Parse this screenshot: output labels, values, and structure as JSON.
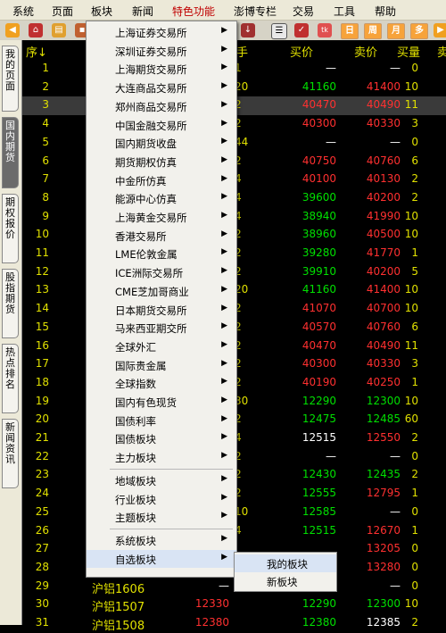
{
  "menubar": [
    "系统",
    "页面",
    "板块",
    "新闻",
    "特色功能",
    "澎博专栏",
    "交易",
    "工具",
    "帮助"
  ],
  "vtabs": [
    "我的页面",
    "国内期货",
    "期权报价",
    "股指期货",
    "热点排名",
    "新闻资讯"
  ],
  "headers": {
    "idx": "序↓",
    "name": "手",
    "buy": "买价",
    "sell": "卖价",
    "buyvol": "买量",
    "sellvol": "卖"
  },
  "toolbar": {
    "btn1": "日",
    "btn2": "周",
    "btn3": "月",
    "btn4": "多"
  },
  "menu_items": [
    {
      "label": "上海证券交易所",
      "sub": true
    },
    {
      "label": "深圳证券交易所",
      "sub": true
    },
    {
      "label": "上海期货交易所",
      "sub": true
    },
    {
      "label": "大连商品交易所",
      "sub": true
    },
    {
      "label": "郑州商品交易所",
      "sub": true
    },
    {
      "label": "中国金融交易所",
      "sub": true
    },
    {
      "label": "国内期货收盘",
      "sub": true
    },
    {
      "label": "期货期权仿真",
      "sub": true
    },
    {
      "label": "中金所仿真",
      "sub": true
    },
    {
      "label": "能源中心仿真",
      "sub": true
    },
    {
      "label": "上海黄金交易所",
      "sub": true
    },
    {
      "label": "香港交易所",
      "sub": true
    },
    {
      "label": "LME伦敦金属",
      "sub": true
    },
    {
      "label": "ICE洲际交易所",
      "sub": true
    },
    {
      "label": "CME芝加哥商业",
      "sub": true
    },
    {
      "label": "日本期货交易所",
      "sub": true
    },
    {
      "label": "马来西亚期交所",
      "sub": true
    },
    {
      "label": "全球外汇",
      "sub": true
    },
    {
      "label": "国际贵金属",
      "sub": true
    },
    {
      "label": "全球指数",
      "sub": true
    },
    {
      "label": "国内有色现货",
      "sub": true
    },
    {
      "label": "国债利率",
      "sub": true
    },
    {
      "label": "国债板块",
      "sub": true
    },
    {
      "label": "主力板块",
      "sub": true
    },
    {
      "label": "地域板块",
      "sub": true
    },
    {
      "label": "行业板块",
      "sub": true
    },
    {
      "label": "主题板块",
      "sub": true
    },
    {
      "label": "系统板块",
      "sub": true
    },
    {
      "label": "自选板块",
      "sub": true
    }
  ],
  "submenu": [
    "我的板块",
    "新板块"
  ],
  "rows": [
    {
      "i": "1",
      "n": "1",
      "b": "—",
      "s": "—",
      "bv": "0",
      "bc": "w",
      "sc": "w"
    },
    {
      "i": "2",
      "n": "20",
      "b": "41160",
      "s": "41400",
      "bv": "10",
      "bc": "g",
      "sc": "r"
    },
    {
      "i": "3",
      "n": "2",
      "b": "40470",
      "s": "40490",
      "bv": "11",
      "bc": "r",
      "sc": "r"
    },
    {
      "i": "4",
      "n": "2",
      "b": "40300",
      "s": "40330",
      "bv": "3",
      "bc": "r",
      "sc": "r"
    },
    {
      "i": "5",
      "n": "44",
      "b": "—",
      "s": "—",
      "bv": "0",
      "bc": "w",
      "sc": "w"
    },
    {
      "i": "6",
      "n": "2",
      "b": "40750",
      "s": "40760",
      "bv": "6",
      "bc": "r",
      "sc": "r"
    },
    {
      "i": "7",
      "n": "4",
      "b": "40100",
      "s": "40130",
      "bv": "2",
      "bc": "r",
      "sc": "r"
    },
    {
      "i": "8",
      "n": "4",
      "b": "39600",
      "s": "40200",
      "bv": "2",
      "bc": "g",
      "sc": "r"
    },
    {
      "i": "9",
      "n": "4",
      "b": "38940",
      "s": "41990",
      "bv": "10",
      "bc": "g",
      "sc": "r"
    },
    {
      "i": "10",
      "n": "2",
      "b": "38960",
      "s": "40500",
      "bv": "10",
      "bc": "g",
      "sc": "r"
    },
    {
      "i": "11",
      "n": "2",
      "b": "39280",
      "s": "41770",
      "bv": "1",
      "bc": "g",
      "sc": "r"
    },
    {
      "i": "12",
      "n": "2",
      "b": "39910",
      "s": "40200",
      "bv": "5",
      "bc": "g",
      "sc": "r"
    },
    {
      "i": "13",
      "n": "20",
      "b": "41160",
      "s": "41400",
      "bv": "10",
      "bc": "g",
      "sc": "r"
    },
    {
      "i": "14",
      "n": "2",
      "b": "41070",
      "s": "40700",
      "bv": "10",
      "bc": "r",
      "sc": "r"
    },
    {
      "i": "15",
      "n": "2",
      "b": "40570",
      "s": "40760",
      "bv": "6",
      "bc": "r",
      "sc": "r"
    },
    {
      "i": "16",
      "n": "2",
      "b": "40470",
      "s": "40490",
      "bv": "11",
      "bc": "r",
      "sc": "r"
    },
    {
      "i": "17",
      "n": "2",
      "b": "40300",
      "s": "40330",
      "bv": "3",
      "bc": "r",
      "sc": "r"
    },
    {
      "i": "18",
      "n": "2",
      "b": "40190",
      "s": "40250",
      "bv": "1",
      "bc": "r",
      "sc": "r"
    },
    {
      "i": "19",
      "n": "30",
      "b": "12290",
      "s": "12300",
      "bv": "10",
      "bc": "g",
      "sc": "g"
    },
    {
      "i": "20",
      "n": "2",
      "b": "12475",
      "s": "12485",
      "bv": "60",
      "bc": "g",
      "sc": "g"
    },
    {
      "i": "21",
      "n": "4",
      "b": "12515",
      "s": "12550",
      "bv": "2",
      "bc": "w",
      "sc": "r"
    },
    {
      "i": "22",
      "n": "2",
      "b": "—",
      "s": "—",
      "bv": "0",
      "bc": "w",
      "sc": "w"
    },
    {
      "i": "23",
      "n": "2",
      "b": "12430",
      "s": "12435",
      "bv": "2",
      "bc": "g",
      "sc": "g"
    },
    {
      "i": "24",
      "n": "2",
      "b": "12555",
      "s": "12795",
      "bv": "1",
      "bc": "g",
      "sc": "r"
    },
    {
      "i": "25",
      "n": "10",
      "b": "12585",
      "s": "—",
      "bv": "0",
      "bc": "g",
      "sc": "w"
    },
    {
      "i": "26",
      "n": "4",
      "b": "12515",
      "s": "12670",
      "bv": "1",
      "bc": "g",
      "sc": "r"
    },
    {
      "i": "27",
      "n": "",
      "b": "",
      "s": "13205",
      "bv": "0",
      "bc": "w",
      "sc": "r"
    },
    {
      "i": "28",
      "n": "",
      "b": "",
      "s": "13280",
      "bv": "0",
      "bc": "w",
      "sc": "r"
    },
    {
      "i": "29",
      "n": "沪铝1606",
      "b": "—",
      "s": "—",
      "bv": "0",
      "bc": "w",
      "sc": "w",
      "last": "—"
    },
    {
      "i": "30",
      "n": "沪铝1507",
      "b": "12290",
      "s": "12300",
      "bv": "10",
      "bc": "g",
      "sc": "g",
      "last": "12330"
    },
    {
      "i": "31",
      "n": "沪铝1508",
      "b": "12380",
      "s": "12385",
      "bv": "2",
      "bc": "g",
      "sc": "w",
      "last": "12380"
    }
  ]
}
